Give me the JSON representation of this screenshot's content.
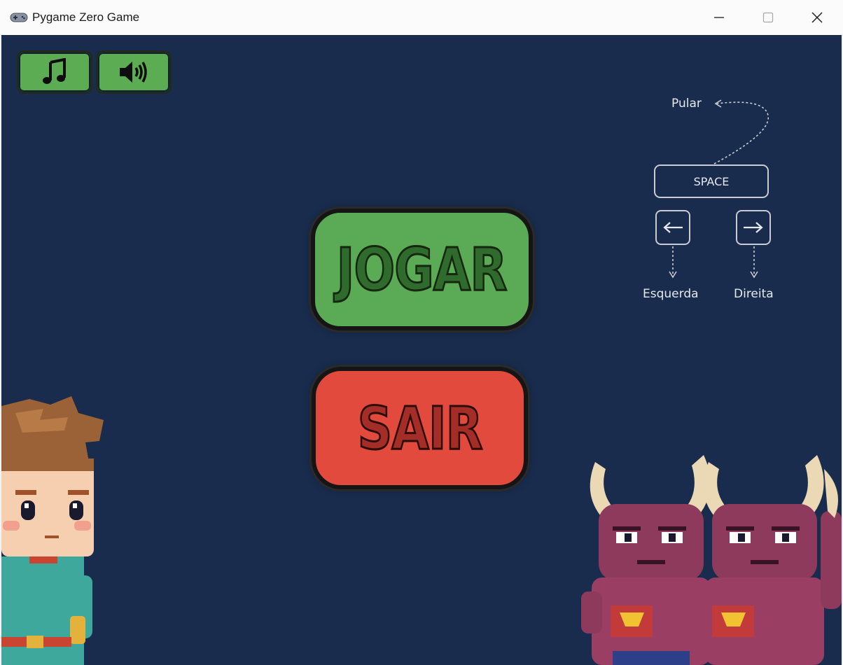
{
  "window": {
    "title": "Pygame Zero Game",
    "controls": {
      "minimize": "minimize",
      "maximize": "maximize",
      "close": "close"
    }
  },
  "canvas": {
    "background": "#192c4d"
  },
  "toggles": {
    "music": {
      "icon": "music-note-icon"
    },
    "sound": {
      "icon": "speaker-icon"
    }
  },
  "menu": {
    "play_label": "JOGAR",
    "quit_label": "SAIR"
  },
  "controls_guide": {
    "jump_label": "Pular",
    "space_key": "SPACE",
    "left_label": "Esquerda",
    "right_label": "Direita"
  },
  "colors": {
    "play_button": "#5aaa56",
    "quit_button": "#e24a3e",
    "toggle": "#5bac52"
  }
}
